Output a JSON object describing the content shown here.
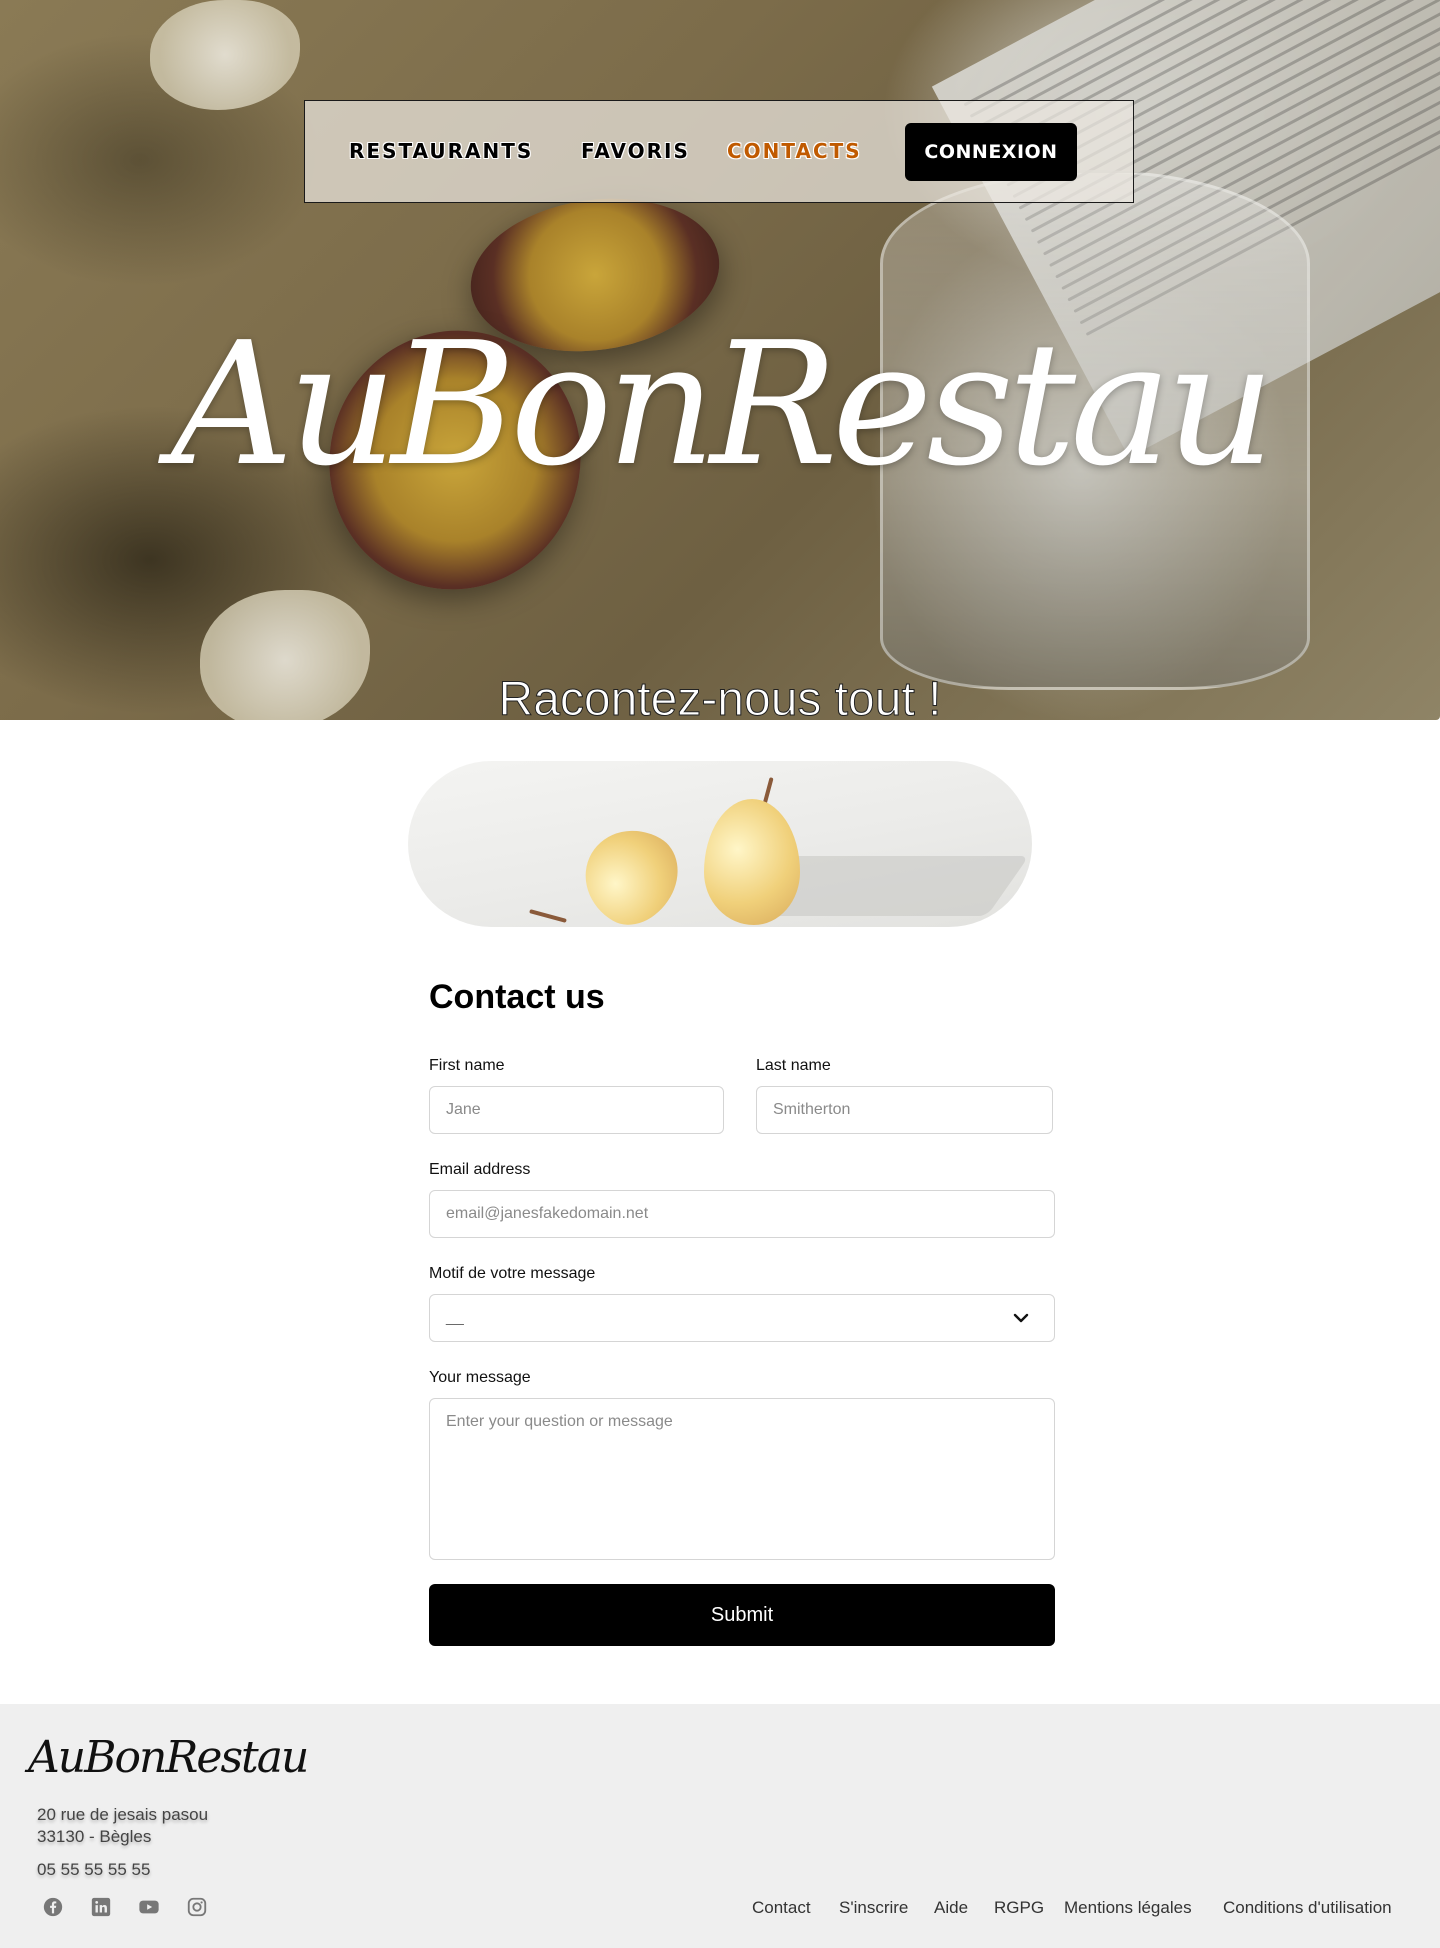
{
  "nav": {
    "links": [
      "RESTAURANTS",
      "FAVORIS",
      "CONTACTS"
    ],
    "active": "CONTACTS",
    "login_label": "CONNEXION",
    "active_color": "#c05a00"
  },
  "hero": {
    "logo": "AuBonRestau",
    "tagline": "Racontez-nous tout !"
  },
  "form": {
    "title": "Contact us",
    "first_name": {
      "label": "First name",
      "placeholder": "Jane"
    },
    "last_name": {
      "label": "Last name",
      "placeholder": "Smitherton"
    },
    "email": {
      "label": "Email address",
      "placeholder": "email@janesfakedomain.net"
    },
    "reason": {
      "label": "Motif de votre message",
      "value": "__"
    },
    "message": {
      "label": "Your message",
      "placeholder": "Enter your question or message"
    },
    "submit_label": "Submit"
  },
  "footer": {
    "logo": "AuBonRestau",
    "address_line1": "20 rue de jesais pasou",
    "address_line2": "33130 - Bègles",
    "phone": "05 55 55 55 55",
    "social": [
      "facebook-icon",
      "linkedin-icon",
      "youtube-icon",
      "instagram-icon"
    ],
    "links": [
      "Contact",
      "S'inscrire",
      "Aide",
      "RGPG",
      "Mentions légales",
      "Conditions d'utilisation"
    ]
  }
}
